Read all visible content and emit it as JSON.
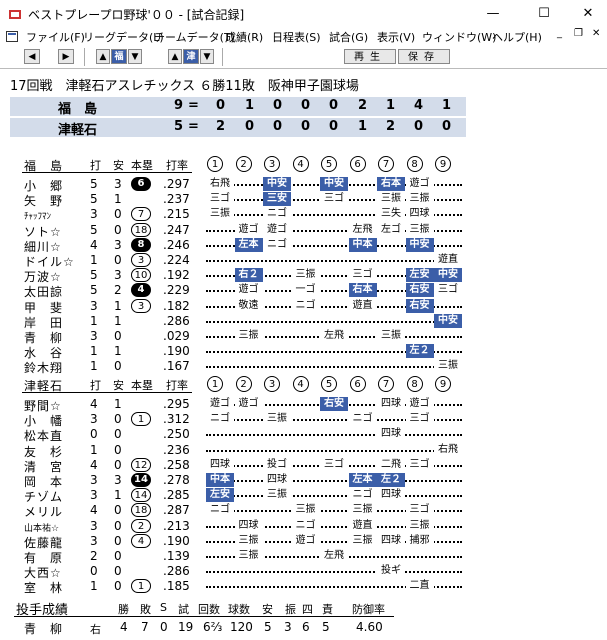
{
  "window": {
    "title": "ベストプレープロ野球'００ - [試合記録]",
    "min": "—",
    "max": "☐",
    "close": "✕"
  },
  "menu": [
    "ファイル(F)",
    "リーグデータ(L)",
    "チームデータ(T)",
    "成績(R)",
    "日程表(S)",
    "試合(G)",
    "表示(V)",
    "ウィンドウ(W)",
    "ヘルプ(H)"
  ],
  "mdi": {
    "min": "_",
    "restore": "❐",
    "close": "✕"
  },
  "toolbar": {
    "team1": "福",
    "team2": "津",
    "play": "再生",
    "save": "保存"
  },
  "game": {
    "info": "17回戦　津軽石アスレチックス ６勝11敗　阪神甲子園球場"
  },
  "score": {
    "rows": [
      {
        "team": "福　島",
        "runs": "9",
        "innings": [
          "0",
          "1",
          "0",
          "0",
          "0",
          "2",
          "1",
          "4",
          "1"
        ]
      },
      {
        "team": "津軽石",
        "runs": "5",
        "innings": [
          "2",
          "0",
          "0",
          "0",
          "0",
          "1",
          "2",
          "0",
          "0"
        ]
      }
    ],
    "eq": "="
  },
  "colors": {
    "accent": "#3b5ea8",
    "score_bg": "#d3dcea"
  },
  "batting_headers": {
    "at_bats": "打",
    "hits": "安",
    "hr": "本塁",
    "avg": "打率"
  },
  "inning_numbers": [
    "1",
    "2",
    "3",
    "4",
    "5",
    "6",
    "7",
    "8",
    "9"
  ],
  "team1": {
    "name": "福　島",
    "players": [
      {
        "name": "小　郷",
        "ab": "5",
        "h": "3",
        "hr": "6",
        "hrs": "f",
        "avg": ".297",
        "pa": [
          {
            "i": 0,
            "t": "右飛"
          },
          {
            "i": 2,
            "t": "中安",
            "b": 1
          },
          {
            "i": 4,
            "t": "中安",
            "b": 1
          },
          {
            "i": 6,
            "t": "右本",
            "b": 1
          },
          {
            "i": 7,
            "t": "遊ゴ"
          }
        ]
      },
      {
        "name": "矢　野",
        "ab": "5",
        "h": "1",
        "hr": "",
        "avg": ".237",
        "pa": [
          {
            "i": 0,
            "t": "三ゴ"
          },
          {
            "i": 2,
            "t": "三安",
            "b": 1
          },
          {
            "i": 4,
            "t": "三ゴ"
          },
          {
            "i": 6,
            "t": "三振"
          },
          {
            "i": 7,
            "t": "三振"
          }
        ]
      },
      {
        "name": "ﾁｬｯﾌﾏﾝ",
        "ab": "3",
        "h": "0",
        "hr": "7",
        "hrs": "o",
        "avg": ".215",
        "sm": 1,
        "pa": [
          {
            "i": 0,
            "t": "三振"
          },
          {
            "i": 2,
            "t": "ニゴ"
          },
          {
            "i": 6,
            "t": "三失"
          },
          {
            "i": 7,
            "t": "四球"
          }
        ]
      },
      {
        "name": "ソト☆",
        "ab": "5",
        "h": "0",
        "hr": "18",
        "hrs": "o",
        "avg": ".247",
        "pa": [
          {
            "i": 1,
            "t": "遊ゴ"
          },
          {
            "i": 2,
            "t": "遊ゴ"
          },
          {
            "i": 5,
            "t": "左飛"
          },
          {
            "i": 6,
            "t": "左ゴ"
          },
          {
            "i": 7,
            "t": "三振"
          }
        ]
      },
      {
        "name": "細川☆",
        "ab": "4",
        "h": "3",
        "hr": "8",
        "hrs": "f",
        "avg": ".246",
        "pa": [
          {
            "i": 1,
            "t": "左本",
            "b": 1
          },
          {
            "i": 2,
            "t": "ニゴ"
          },
          {
            "i": 5,
            "t": "中本",
            "b": 1
          },
          {
            "i": 7,
            "t": "中安",
            "b": 1
          }
        ]
      },
      {
        "name": "ドイル☆",
        "ab": "1",
        "h": "0",
        "hr": "3",
        "hrs": "o",
        "avg": ".224",
        "pa": [
          {
            "i": 8,
            "t": "遊直"
          }
        ]
      },
      {
        "name": "万波☆",
        "ab": "5",
        "h": "3",
        "hr": "10",
        "hrs": "o",
        "avg": ".192",
        "pa": [
          {
            "i": 1,
            "t": "右２",
            "b": 1
          },
          {
            "i": 3,
            "t": "三振"
          },
          {
            "i": 5,
            "t": "三ゴ"
          },
          {
            "i": 7,
            "t": "左安",
            "b": 1
          },
          {
            "i": 8,
            "t": "中安",
            "b": 1
          }
        ]
      },
      {
        "name": "太田諒",
        "ab": "5",
        "h": "2",
        "hr": "4",
        "hrs": "f",
        "avg": ".229",
        "pa": [
          {
            "i": 1,
            "t": "遊ゴ"
          },
          {
            "i": 3,
            "t": "一ゴ"
          },
          {
            "i": 5,
            "t": "右本",
            "b": 1
          },
          {
            "i": 7,
            "t": "右安",
            "b": 1
          },
          {
            "i": 8,
            "t": "三ゴ"
          }
        ]
      },
      {
        "name": "甲　斐",
        "ab": "3",
        "h": "1",
        "hr": "3",
        "hrs": "o",
        "avg": ".182",
        "pa": [
          {
            "i": 1,
            "t": "敬遠"
          },
          {
            "i": 3,
            "t": "ニゴ"
          },
          {
            "i": 5,
            "t": "遊直"
          },
          {
            "i": 7,
            "t": "右安",
            "b": 1
          }
        ]
      },
      {
        "name": "岸　田",
        "ab": "1",
        "h": "1",
        "hr": "",
        "avg": ".286",
        "pa": [
          {
            "i": 8,
            "t": "中安",
            "b": 1
          }
        ]
      },
      {
        "name": "青　柳",
        "ab": "3",
        "h": "0",
        "hr": "",
        "avg": ".029",
        "pa": [
          {
            "i": 1,
            "t": "三振"
          },
          {
            "i": 4,
            "t": "左飛"
          },
          {
            "i": 6,
            "t": "三振"
          }
        ]
      },
      {
        "name": "水　谷",
        "ab": "1",
        "h": "1",
        "hr": "",
        "avg": ".190",
        "pa": [
          {
            "i": 7,
            "t": "左２",
            "b": 1
          }
        ]
      },
      {
        "name": "鈴木翔",
        "ab": "1",
        "h": "0",
        "hr": "",
        "avg": ".167",
        "pa": [
          {
            "i": 8,
            "t": "三振"
          }
        ]
      }
    ]
  },
  "team2": {
    "name": "津軽石",
    "players": [
      {
        "name": "野間☆",
        "ab": "4",
        "h": "1",
        "hr": "",
        "avg": ".295",
        "pa": [
          {
            "i": 0,
            "t": "遊ゴ"
          },
          {
            "i": 1,
            "t": "遊ゴ"
          },
          {
            "i": 4,
            "t": "右安",
            "b": 1
          },
          {
            "i": 6,
            "t": "四球"
          },
          {
            "i": 7,
            "t": "遊ゴ"
          }
        ]
      },
      {
        "name": "小　幡",
        "ab": "3",
        "h": "0",
        "hr": "1",
        "hrs": "o",
        "avg": ".312",
        "pa": [
          {
            "i": 0,
            "t": "ニゴ"
          },
          {
            "i": 2,
            "t": "三振"
          },
          {
            "i": 5,
            "t": "ニゴ"
          },
          {
            "i": 7,
            "t": "三ゴ"
          }
        ]
      },
      {
        "name": "松本直",
        "ab": "0",
        "h": "0",
        "hr": "",
        "avg": ".250",
        "pa": [
          {
            "i": 6,
            "t": "四球"
          }
        ]
      },
      {
        "name": "友　杉",
        "ab": "1",
        "h": "0",
        "hr": "",
        "avg": ".236",
        "pa": [
          {
            "i": 8,
            "t": "右飛"
          }
        ]
      },
      {
        "name": "清　宮",
        "ab": "4",
        "h": "0",
        "hr": "12",
        "hrs": "o",
        "avg": ".258",
        "pa": [
          {
            "i": 0,
            "t": "四球"
          },
          {
            "i": 2,
            "t": "投ゴ"
          },
          {
            "i": 4,
            "t": "三ゴ"
          },
          {
            "i": 6,
            "t": "二飛"
          },
          {
            "i": 7,
            "t": "三ゴ"
          }
        ]
      },
      {
        "name": "岡　本",
        "ab": "3",
        "h": "3",
        "hr": "14",
        "hrs": "f",
        "avg": ".278",
        "pa": [
          {
            "i": 0,
            "t": "中本",
            "b": 1
          },
          {
            "i": 2,
            "t": "四球"
          },
          {
            "i": 5,
            "t": "左本",
            "b": 1
          },
          {
            "i": 6,
            "t": "左２",
            "b": 1
          }
        ]
      },
      {
        "name": "チゾム",
        "ab": "3",
        "h": "1",
        "hr": "14",
        "hrs": "o",
        "avg": ".285",
        "pa": [
          {
            "i": 0,
            "t": "左安",
            "b": 1
          },
          {
            "i": 2,
            "t": "三振"
          },
          {
            "i": 5,
            "t": "ニゴ"
          },
          {
            "i": 6,
            "t": "四球"
          }
        ]
      },
      {
        "name": "メリル",
        "ab": "4",
        "h": "0",
        "hr": "18",
        "hrs": "o",
        "avg": ".287",
        "pa": [
          {
            "i": 0,
            "t": "ニゴ"
          },
          {
            "i": 3,
            "t": "三振"
          },
          {
            "i": 5,
            "t": "三振"
          },
          {
            "i": 7,
            "t": "三ゴ"
          }
        ]
      },
      {
        "name": "山本祐☆",
        "ab": "3",
        "h": "0",
        "hr": "2",
        "hrs": "o",
        "avg": ".213",
        "sm": 1,
        "pa": [
          {
            "i": 1,
            "t": "四球"
          },
          {
            "i": 3,
            "t": "ニゴ"
          },
          {
            "i": 5,
            "t": "遊直"
          },
          {
            "i": 7,
            "t": "三振"
          }
        ]
      },
      {
        "name": "佐藤龍",
        "ab": "3",
        "h": "0",
        "hr": "4",
        "hrs": "o",
        "avg": ".190",
        "pa": [
          {
            "i": 1,
            "t": "三振"
          },
          {
            "i": 3,
            "t": "遊ゴ"
          },
          {
            "i": 5,
            "t": "三振"
          },
          {
            "i": 6,
            "t": "四球"
          },
          {
            "i": 7,
            "t": "捕邪"
          }
        ]
      },
      {
        "name": "有　原",
        "ab": "2",
        "h": "0",
        "hr": "",
        "avg": ".139",
        "pa": [
          {
            "i": 1,
            "t": "三振"
          },
          {
            "i": 4,
            "t": "左飛"
          }
        ]
      },
      {
        "name": "大西☆",
        "ab": "0",
        "h": "0",
        "hr": "",
        "avg": ".286",
        "pa": [
          {
            "i": 6,
            "t": "投ギ"
          }
        ]
      },
      {
        "name": "室　林",
        "ab": "1",
        "h": "0",
        "hr": "1",
        "hrs": "o",
        "avg": ".185",
        "pa": [
          {
            "i": 7,
            "t": "二直"
          }
        ]
      }
    ]
  },
  "pitching": {
    "title": "投手成績",
    "headers": [
      "勝",
      "敗",
      "S",
      "試",
      "回数",
      "球数",
      "安",
      "振",
      "四",
      "責",
      "防御率"
    ],
    "rows": [
      {
        "name": "青　柳",
        "hand": "右",
        "vals": [
          "4",
          "7",
          "0",
          "19",
          "6⅔",
          "120",
          "5",
          "3",
          "6",
          "5",
          "4.60"
        ]
      }
    ]
  }
}
